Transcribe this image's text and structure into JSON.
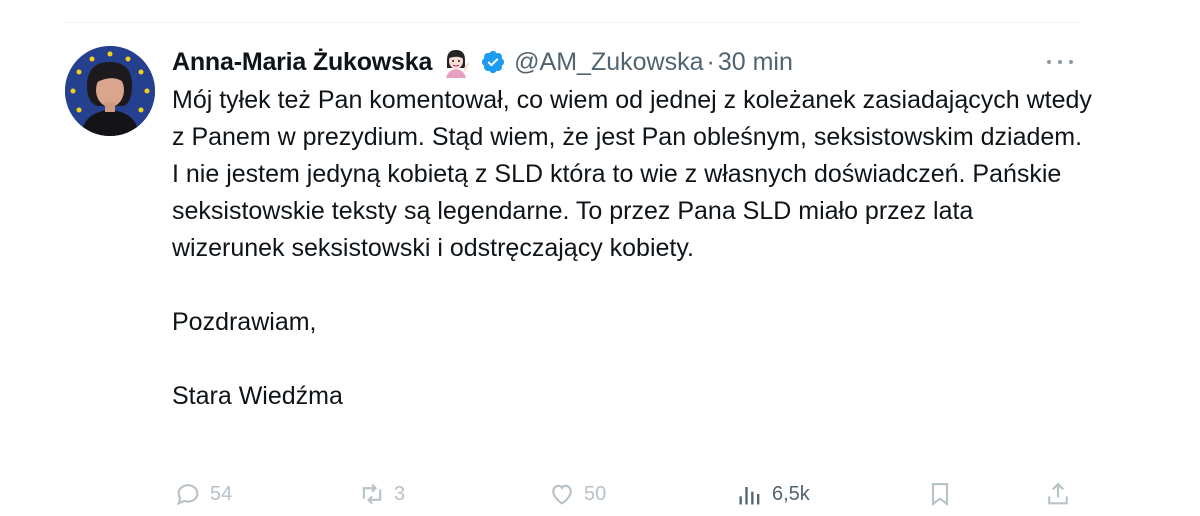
{
  "tweet": {
    "author_name": "Anna-Maria Żukowska",
    "handle": "@AM_Zukowska",
    "separator": "·",
    "time": "30 min",
    "paragraphs": [
      "Mój tyłek też Pan komentował, co wiem od jednej z koleżanek zasiadających wtedy z Panem w prezydium. Stąd wiem, że jest Pan obleśnym, seksistowskim dziadem. I nie jestem jedyną kobietą z SLD która to wie z własnych doświadczeń. Pańskie seksistowskie teksty są legendarne. To przez Pana SLD miało przez lata wizerunek seksistowski i odstręczający kobiety.",
      "Pozdrawiam,",
      "Stara Wiedźma"
    ]
  },
  "actions": {
    "replies": "54",
    "retweets": "3",
    "likes": "50",
    "views": "6,5k"
  },
  "icons": [
    "avatar",
    "woman-tipping-hand-emoji",
    "verified-badge-icon",
    "more-icon",
    "reply-icon",
    "retweet-icon",
    "like-icon",
    "views-icon",
    "bookmark-icon",
    "share-icon"
  ],
  "colors": {
    "verified": "#1d9bf0",
    "muted": "#536471",
    "faded": "#b7c1c8",
    "avatar_bg": "#24408e"
  }
}
